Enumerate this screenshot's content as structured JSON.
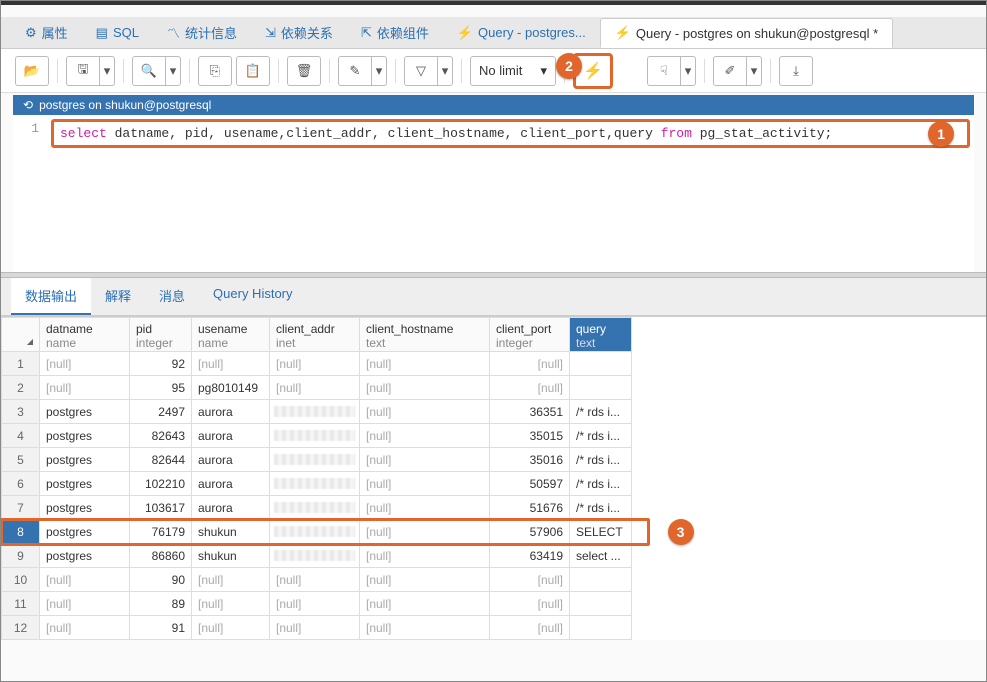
{
  "tabs": [
    {
      "label": "属性",
      "icon": "gear"
    },
    {
      "label": "SQL",
      "icon": "doc"
    },
    {
      "label": "统计信息",
      "icon": "chart"
    },
    {
      "label": "依赖关系",
      "icon": "dep"
    },
    {
      "label": "依赖组件",
      "icon": "dep"
    },
    {
      "label": "Query - postgres...",
      "icon": "bolt"
    },
    {
      "label": "Query - postgres on shukun@postgresql *",
      "icon": "bolt"
    }
  ],
  "toolbar": {
    "limit_label": "No limit"
  },
  "connection": "postgres on shukun@postgresql",
  "editor": {
    "line": "1",
    "sql_select": "select",
    "sql_cols": " datname, pid, usename,client_addr, client_hostname, client_port,query ",
    "sql_from": "from",
    "sql_table": " pg_stat_activity;"
  },
  "result_tabs": [
    "数据输出",
    "解释",
    "消息",
    "Query History"
  ],
  "columns": [
    {
      "name": "datname",
      "type": "name"
    },
    {
      "name": "pid",
      "type": "integer"
    },
    {
      "name": "usename",
      "type": "name"
    },
    {
      "name": "client_addr",
      "type": "inet"
    },
    {
      "name": "client_hostname",
      "type": "text"
    },
    {
      "name": "client_port",
      "type": "integer"
    },
    {
      "name": "query",
      "type": "text"
    }
  ],
  "rows": [
    {
      "n": "1",
      "datname": "[null]",
      "pid": "92",
      "usename": "[null]",
      "addr": "[null]",
      "host": "[null]",
      "port": "[null]",
      "query": ""
    },
    {
      "n": "2",
      "datname": "[null]",
      "pid": "95",
      "usename": "pg8010149",
      "addr": "[null]",
      "host": "[null]",
      "port": "[null]",
      "query": ""
    },
    {
      "n": "3",
      "datname": "postgres",
      "pid": "2497",
      "usename": "aurora",
      "addr": "blur",
      "host": "[null]",
      "port": "36351",
      "query": "/* rds i..."
    },
    {
      "n": "4",
      "datname": "postgres",
      "pid": "82643",
      "usename": "aurora",
      "addr": "blur",
      "host": "[null]",
      "port": "35015",
      "query": "/* rds i..."
    },
    {
      "n": "5",
      "datname": "postgres",
      "pid": "82644",
      "usename": "aurora",
      "addr": "blur",
      "host": "[null]",
      "port": "35016",
      "query": "/* rds i..."
    },
    {
      "n": "6",
      "datname": "postgres",
      "pid": "102210",
      "usename": "aurora",
      "addr": "blur",
      "host": "[null]",
      "port": "50597",
      "query": "/* rds i..."
    },
    {
      "n": "7",
      "datname": "postgres",
      "pid": "103617",
      "usename": "aurora",
      "addr": "blur",
      "host": "[null]",
      "port": "51676",
      "query": "/* rds i..."
    },
    {
      "n": "8",
      "datname": "postgres",
      "pid": "76179",
      "usename": "shukun",
      "addr": "blur",
      "host": "[null]",
      "port": "57906",
      "query": "SELECT"
    },
    {
      "n": "9",
      "datname": "postgres",
      "pid": "86860",
      "usename": "shukun",
      "addr": "blur",
      "host": "[null]",
      "port": "63419",
      "query": "select ..."
    },
    {
      "n": "10",
      "datname": "[null]",
      "pid": "90",
      "usename": "[null]",
      "addr": "[null]",
      "host": "[null]",
      "port": "[null]",
      "query": ""
    },
    {
      "n": "11",
      "datname": "[null]",
      "pid": "89",
      "usename": "[null]",
      "addr": "[null]",
      "host": "[null]",
      "port": "[null]",
      "query": ""
    },
    {
      "n": "12",
      "datname": "[null]",
      "pid": "91",
      "usename": "[null]",
      "addr": "[null]",
      "host": "[null]",
      "port": "[null]",
      "query": ""
    }
  ],
  "callouts": {
    "c1": "1",
    "c2": "2",
    "c3": "3"
  },
  "highlight_row": 8
}
